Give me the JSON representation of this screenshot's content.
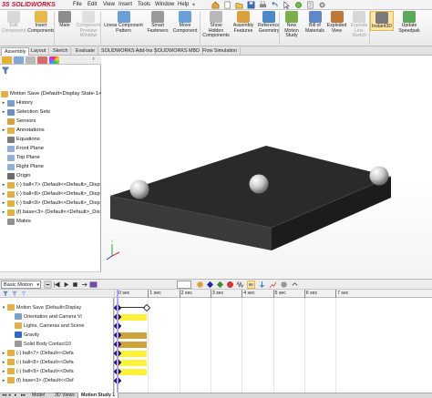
{
  "app": {
    "logo_brand": "SOLIDWORKS",
    "logo_prefix": "3S"
  },
  "menu": {
    "items": [
      "File",
      "Edit",
      "View",
      "Insert",
      "Tools",
      "Window",
      "Help"
    ]
  },
  "ribbon": {
    "buttons": [
      {
        "label": "Edit\nComponent",
        "enabled": false,
        "icon": "edit-component-icon"
      },
      {
        "label": "Insert\nComponents",
        "enabled": true,
        "icon": "insert-components-icon"
      },
      {
        "label": "Mate",
        "enabled": true,
        "icon": "mate-icon"
      },
      {
        "label": "Component\nPreview\nWindow",
        "enabled": false,
        "icon": "preview-window-icon"
      },
      {
        "label": "Linear Component\nPattern",
        "enabled": true,
        "icon": "linear-pattern-icon"
      },
      {
        "label": "Smart\nFasteners",
        "enabled": true,
        "icon": "smart-fasteners-icon"
      },
      {
        "label": "Move\nComponent",
        "enabled": true,
        "icon": "move-component-icon"
      },
      {
        "label": "Show\nHidden\nComponents",
        "enabled": true,
        "icon": "show-hidden-icon"
      },
      {
        "label": "Assembly\nFeatures",
        "enabled": true,
        "icon": "assembly-features-icon"
      },
      {
        "label": "Reference\nGeometry",
        "enabled": true,
        "icon": "reference-geometry-icon"
      },
      {
        "label": "New\nMotion\nStudy",
        "enabled": true,
        "icon": "new-motion-study-icon"
      },
      {
        "label": "Bill of\nMaterials",
        "enabled": true,
        "icon": "bom-icon"
      },
      {
        "label": "Exploded\nView",
        "enabled": true,
        "icon": "exploded-view-icon"
      },
      {
        "label": "Explode\nLine\nSketch",
        "enabled": false,
        "icon": "explode-line-sketch-icon"
      },
      {
        "label": "Instant3D",
        "enabled": true,
        "active": true,
        "icon": "instant3d-icon"
      },
      {
        "label": "Update\nSpeedpak",
        "enabled": true,
        "icon": "update-speedpak-icon"
      }
    ]
  },
  "command_tabs": [
    "Assembly",
    "Layout",
    "Sketch",
    "Evaluate",
    "SOLIDWORKS Add-Ins",
    "SOLIDWORKS MBD",
    "Flow Simulation"
  ],
  "feature_tree": {
    "root": "Motion Save  (Default<Display State-1>)",
    "items": [
      {
        "label": "History",
        "icon": "history-icon",
        "expandable": true
      },
      {
        "label": "Selection Sets",
        "icon": "selection-sets-icon",
        "expandable": true
      },
      {
        "label": "Sensors",
        "icon": "sensors-icon",
        "expandable": false
      },
      {
        "label": "Annotations",
        "icon": "annotations-icon",
        "expandable": true
      },
      {
        "label": "Equations",
        "icon": "equations-icon",
        "expandable": false
      },
      {
        "label": "Front Plane",
        "icon": "plane-icon",
        "expandable": false
      },
      {
        "label": "Top Plane",
        "icon": "plane-icon",
        "expandable": false
      },
      {
        "label": "Right Plane",
        "icon": "plane-icon",
        "expandable": false
      },
      {
        "label": "Origin",
        "icon": "origin-icon",
        "expandable": false
      },
      {
        "label": "(-) ball<7> (Default<<Default>_Disp",
        "icon": "part-icon",
        "expandable": true
      },
      {
        "label": "(-) ball<8> (Default<<Default>_Disp",
        "icon": "part-icon",
        "expandable": true
      },
      {
        "label": "(-) ball<9> (Default<<Default>_Disp",
        "icon": "part-icon",
        "expandable": true
      },
      {
        "label": "(f) base<3> (Default<<Default>_Dis",
        "icon": "part-icon",
        "expandable": true
      },
      {
        "label": "Mates",
        "icon": "mates-icon",
        "expandable": false
      }
    ]
  },
  "motion": {
    "study_type": "Basic Motion",
    "tree": {
      "root": "Motion Save  (Default<Display",
      "items": [
        {
          "label": "Orientation and Camera Vi",
          "icon": "camera-icon"
        },
        {
          "label": "Lights, Cameras and Scene",
          "icon": "lights-icon"
        },
        {
          "label": "Gravity",
          "icon": "gravity-icon"
        },
        {
          "label": "Solid Body Contact10",
          "icon": "contact-icon"
        },
        {
          "label": "(-) ball<7> (Default<<Defa",
          "icon": "part-icon"
        },
        {
          "label": "(-) ball<8> (Default<<Defa",
          "icon": "part-icon"
        },
        {
          "label": "(-) ball<9> (Default<<Defa",
          "icon": "part-icon"
        },
        {
          "label": "(f) base<3> (Default<<Def",
          "icon": "part-icon"
        }
      ]
    },
    "timeline": {
      "ticks": [
        "0 sec",
        "1 sec",
        "2 sec",
        "3 sec",
        "4 sec",
        "5 sec",
        "6 sec",
        "7 sec"
      ],
      "current_time_sec": 0,
      "keyframes_at_sec": 0
    }
  },
  "bottom_tabs": [
    {
      "label": "Model",
      "active": false
    },
    {
      "label": "3D Views",
      "active": false
    },
    {
      "label": "Motion Study 1",
      "active": true
    }
  ],
  "colors": {
    "accent": "#c8102e",
    "keyframe": "#1e2aa8",
    "track_gold": "#cfa33c",
    "track_yellow": "#fff23a",
    "time_bar": "#b8a0ff"
  }
}
